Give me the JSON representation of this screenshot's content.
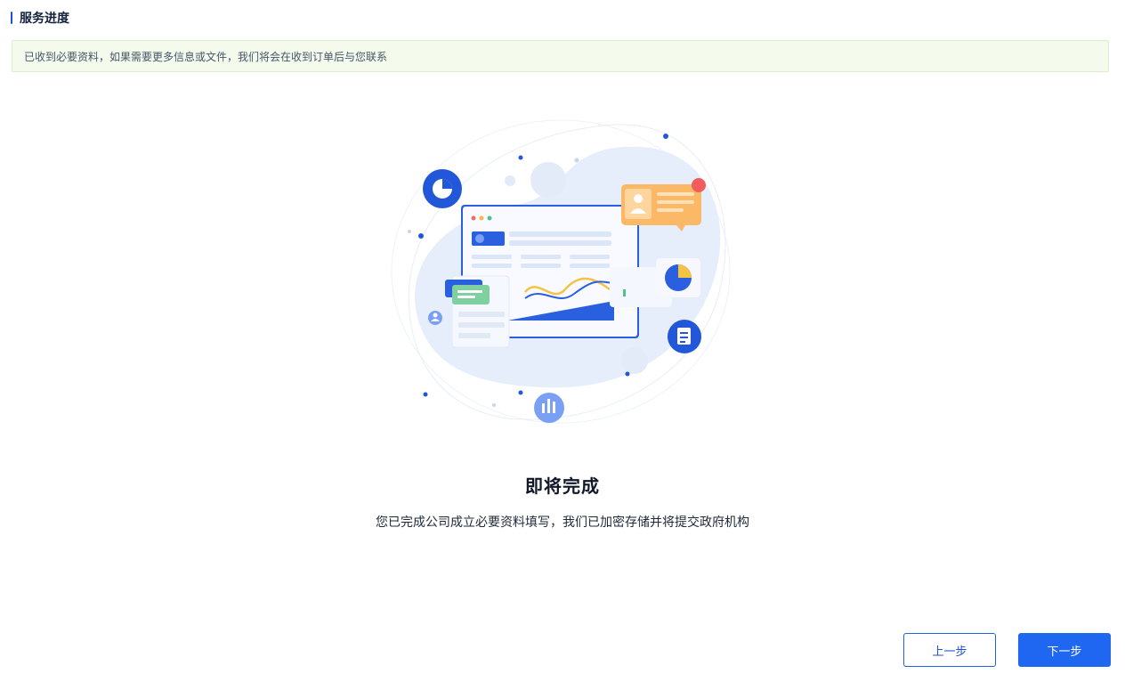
{
  "header": {
    "title": "服务进度"
  },
  "notice": {
    "text": "已收到必要资料，如果需要更多信息或文件，我们将会在收到订单后与您联系"
  },
  "status": {
    "title": "即将完成",
    "description": "您已完成公司成立必要资料填写，我们已加密存储并将提交政府机构"
  },
  "actions": {
    "prev_label": "上一步",
    "next_label": "下一步"
  },
  "colors": {
    "primary": "#1f66f0",
    "notice_bg": "#f4fbec",
    "illustration_blob": "#e6eefc"
  }
}
